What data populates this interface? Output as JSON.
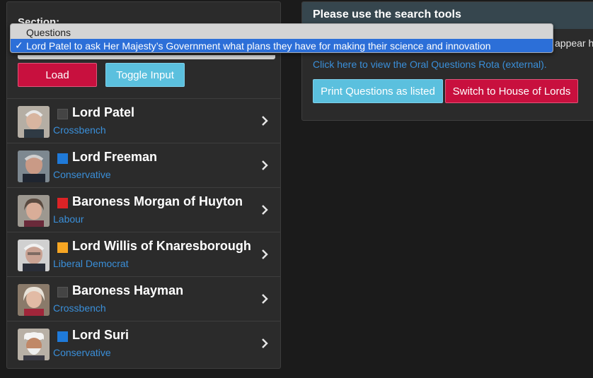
{
  "left": {
    "section_label": "Section:",
    "buttons": {
      "load": "Load",
      "toggle": "Toggle Input"
    },
    "members": [
      {
        "name": "Lord Patel",
        "party": "Crossbench",
        "party_color": "#444444"
      },
      {
        "name": "Lord Freeman",
        "party": "Conservative",
        "party_color": "#1f7ad9"
      },
      {
        "name": "Baroness Morgan of Huyton",
        "party": "Labour",
        "party_color": "#dc2326"
      },
      {
        "name": "Lord Willis of Knaresborough",
        "party": "Liberal Democrat",
        "party_color": "#f6a623"
      },
      {
        "name": "Baroness Hayman",
        "party": "Crossbench",
        "party_color": "#444444"
      },
      {
        "name": "Lord Suri",
        "party": "Conservative",
        "party_color": "#1f7ad9"
      }
    ]
  },
  "right": {
    "title": "Please use the search tools",
    "cut_text": "appear he",
    "rota_link": "Click here to view the Oral Questions Rota (external).",
    "buttons": {
      "print": "Print Questions as listed",
      "switch": "Switch to House of Lords"
    }
  },
  "dropdown": {
    "options": [
      "Questions",
      "Lord Patel to ask Her Majesty’s Government what plans they have for making their science and innovation"
    ],
    "selected_index": 1,
    "check_mark": "✓"
  },
  "colors": {
    "accent_red": "#c8103e",
    "accent_blue": "#5bc0de",
    "link": "#3a8fd9",
    "dropdown_highlight": "#2c6fd8"
  },
  "icons": {
    "row_chevron": "chevron-right-icon",
    "avatar": "portrait-photo"
  }
}
